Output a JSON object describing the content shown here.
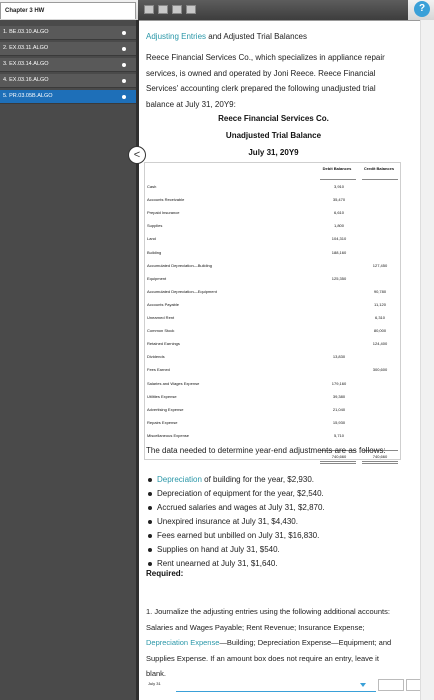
{
  "app": {
    "chapter_tab": "Chapter 3 HW",
    "help": "?"
  },
  "sidebar": {
    "items": [
      {
        "label": "1. BE.03.10.ALGO",
        "active": false
      },
      {
        "label": "2. EX.03.11.ALGO",
        "active": false
      },
      {
        "label": "3. EX.03.14.ALGO",
        "active": false
      },
      {
        "label": "4. EX.03.16.ALGO",
        "active": false
      },
      {
        "label": "5. PR.03.05B.ALGO",
        "active": true
      }
    ],
    "collapse_icon": "<"
  },
  "problem": {
    "heading_teal": "Adjusting Entries",
    "heading_rest": "and Adjusted Trial Balances",
    "intro": "Reece Financial Services Co., which specializes in appliance repair services, is owned and operated by Joni Reece. Reece Financial Services' accounting clerk prepared the following unadjusted trial balance at July 31, 20Y9:",
    "company": "Reece Financial Services Co.",
    "statement": "Unadjusted Trial Balance",
    "date": "July 31, 20Y9"
  },
  "trial_balance": {
    "debit_header": "Debit Balances",
    "credit_header": "Credit Balances",
    "rows": [
      {
        "account": "Cash",
        "debit": "3,910",
        "credit": ""
      },
      {
        "account": "Accounts Receivable",
        "debit": "35,470",
        "credit": ""
      },
      {
        "account": "Prepaid Insurance",
        "debit": "6,610",
        "credit": ""
      },
      {
        "account": "Supplies",
        "debit": "1,800",
        "credit": ""
      },
      {
        "account": "Land",
        "debit": "104,310",
        "credit": ""
      },
      {
        "account": "Building",
        "debit": "188,160",
        "credit": ""
      },
      {
        "account": "Accumulated Depreciation—Building",
        "debit": "",
        "credit": "127,450"
      },
      {
        "account": "Equipment",
        "debit": "125,350",
        "credit": ""
      },
      {
        "account": "Accumulated Depreciation—Equipment",
        "debit": "",
        "credit": "90,780"
      },
      {
        "account": "Accounts Payable",
        "debit": "",
        "credit": "11,120"
      },
      {
        "account": "Unearned Rent",
        "debit": "",
        "credit": "6,310"
      },
      {
        "account": "Common Stock",
        "debit": "",
        "credit": "80,000"
      },
      {
        "account": "Retained Earnings",
        "debit": "",
        "credit": "124,400"
      },
      {
        "account": "Dividends",
        "debit": "13,830",
        "credit": ""
      },
      {
        "account": "Fees Earned",
        "debit": "",
        "credit": "300,600"
      },
      {
        "account": "Salaries and Wages Expense",
        "debit": "179,160",
        "credit": ""
      },
      {
        "account": "Utilities Expense",
        "debit": "39,380",
        "credit": ""
      },
      {
        "account": "Advertising Expense",
        "debit": "21,040",
        "credit": ""
      },
      {
        "account": "Repairs Expense",
        "debit": "15,930",
        "credit": ""
      },
      {
        "account": "Miscellaneous Expense",
        "debit": "5,710",
        "credit": ""
      }
    ],
    "total_debit": "740,660",
    "total_credit": "740,660"
  },
  "adjustments": {
    "intro": "The data needed to determine year-end adjustments are as follows:",
    "items": [
      {
        "teal": "Depreciation",
        "text": " of building for the year, $2,930."
      },
      {
        "teal": "",
        "text": "Depreciation of equipment for the year, $2,540."
      },
      {
        "teal": "",
        "text": "Accrued salaries and wages at July 31, $2,870."
      },
      {
        "teal": "",
        "text": "Unexpired insurance at July 31, $4,430."
      },
      {
        "teal": "",
        "text": "Fees earned but unbilled on July 31, $16,830."
      },
      {
        "teal": "",
        "text": "Supplies on hand at July 31, $540."
      },
      {
        "teal": "",
        "text": "Rent unearned at July 31, $1,640."
      }
    ]
  },
  "required": {
    "label": "Required:",
    "q1_a": "1.  Journalize the adjusting entries using the following additional accounts: Salaries and Wages Payable; Rent Revenue; Insurance Expense; ",
    "q1_teal": "Depreciation Expense",
    "q1_b": "—Building; Depreciation Expense—Equipment; and Supplies Expense. If an amount box does not require an entry, leave it blank."
  },
  "answer": {
    "date": "July 31"
  }
}
